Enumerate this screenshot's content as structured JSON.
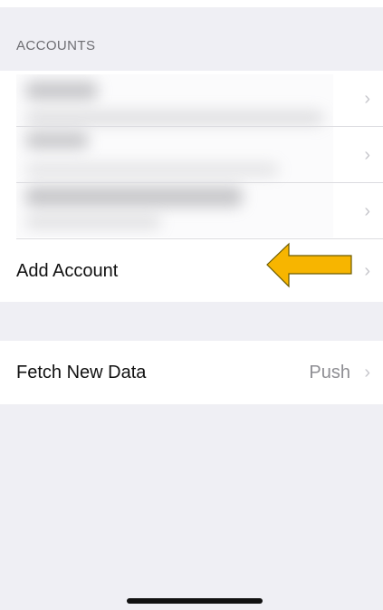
{
  "accounts_section": {
    "header": "ACCOUNTS",
    "add_account_label": "Add Account"
  },
  "fetch_section": {
    "label": "Fetch New Data",
    "value": "Push"
  },
  "icons": {
    "chevron": "chevron-right-icon",
    "annotation_arrow": "arrow-left-icon"
  },
  "colors": {
    "background": "#efeff4",
    "row_background": "#ffffff",
    "secondary_text": "#6d6d72",
    "annotation_arrow": "#f7b500"
  },
  "chevron_glyph": "›"
}
